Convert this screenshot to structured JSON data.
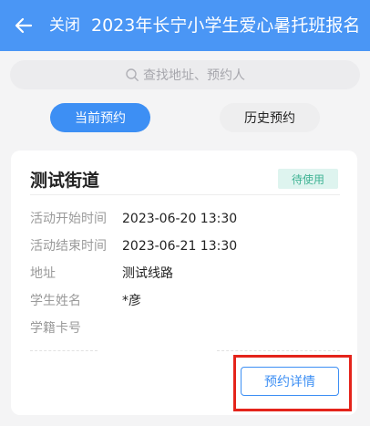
{
  "header": {
    "back_icon": "arrow-left-icon",
    "close_label": "关闭",
    "title": "2023年长宁小学生爱心暑托班报名"
  },
  "search": {
    "icon": "search-icon",
    "placeholder": "查找地址、预约人"
  },
  "tabs": [
    {
      "label": "当前预约",
      "active": true
    },
    {
      "label": "历史预约",
      "active": false
    }
  ],
  "card": {
    "title": "测试街道",
    "status": "待使用",
    "fields": [
      {
        "label": "活动开始时间",
        "value": "2023-06-20 13:30"
      },
      {
        "label": "活动结束时间",
        "value": "2023-06-21 13:30"
      },
      {
        "label": "地址",
        "value": "测试线路"
      },
      {
        "label": "学生姓名",
        "value": "*彦"
      },
      {
        "label": "学籍卡号",
        "value": ""
      }
    ],
    "detail_button": "预约详情"
  },
  "colors": {
    "header_bg": "#4a96f5",
    "accent": "#3d8ff4",
    "status_bg": "#def4ef",
    "status_text": "#3fb394",
    "highlight": "#e4241b"
  }
}
